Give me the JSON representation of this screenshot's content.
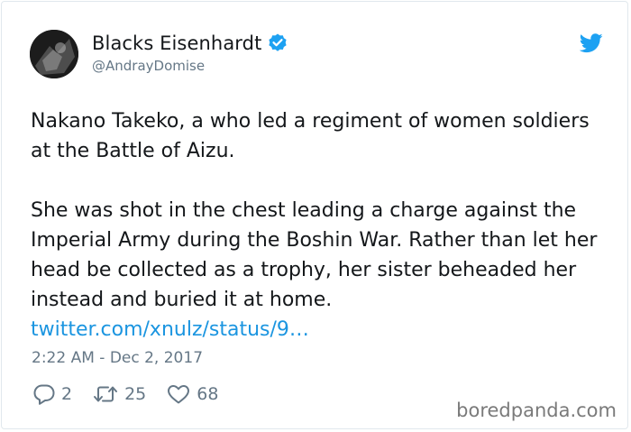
{
  "author": {
    "display_name": "Blacks Eisenhardt",
    "handle": "@AndrayDomise",
    "verified": true
  },
  "icons": {
    "verified": "verified-badge-icon",
    "platform": "twitter-bird-icon",
    "reply": "reply-bubble-icon",
    "retweet": "retweet-icon",
    "like": "heart-icon"
  },
  "tweet": {
    "paragraph_1": "Nakano Takeko, a who led a regiment of women soldiers at the Battle of Aizu.",
    "paragraph_2": "She was shot in the chest leading a charge against the Imperial Army during the Boshin War. Rather than let her head be collected as a trophy, her sister beheaded her instead and buried it at home.",
    "link": "twitter.com/xnulz/status/9…",
    "timestamp": "2:22 AM - Dec 2, 2017"
  },
  "stats": {
    "replies": "2",
    "retweets": "25",
    "likes": "68"
  },
  "watermark": "boredpanda.com",
  "colors": {
    "accent": "#1da1f2",
    "link": "#1b95e0",
    "secondary_text": "#657786",
    "border": "#e1e8ed"
  }
}
